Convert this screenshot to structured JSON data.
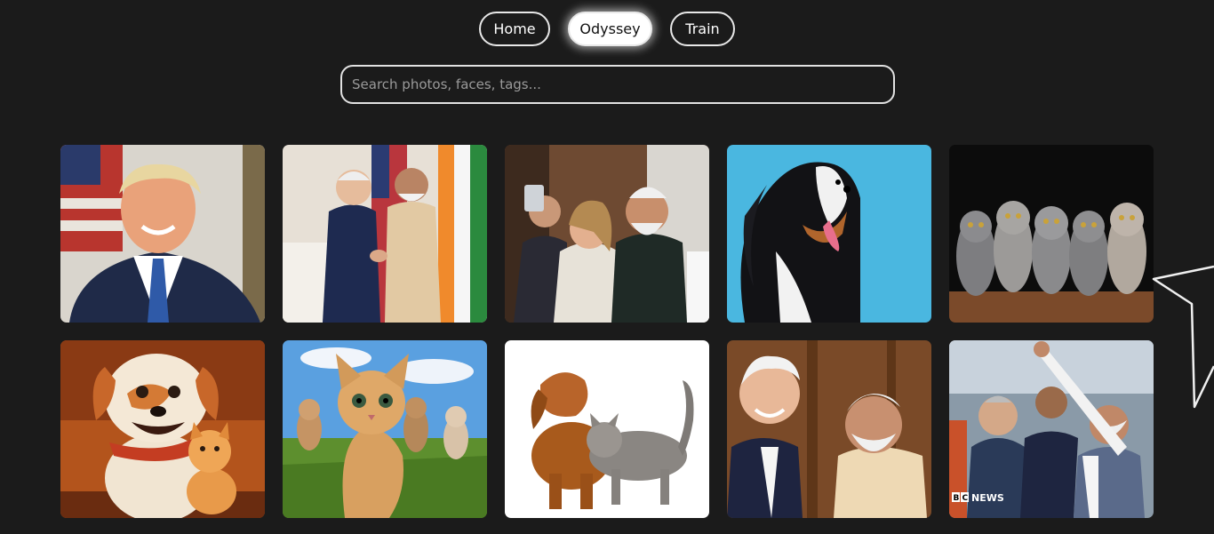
{
  "nav": {
    "home_label": "Home",
    "odyssey_label": "Odyssey",
    "train_label": "Train",
    "active": "Odyssey"
  },
  "search": {
    "placeholder": "Search photos, faces, tags...",
    "value": ""
  },
  "photos": [
    {
      "subject": "man in suit with flag"
    },
    {
      "subject": "two men shaking hands with flags"
    },
    {
      "subject": "group selfie"
    },
    {
      "subject": "dog on blue background"
    },
    {
      "subject": "five kittens"
    },
    {
      "subject": "cartoon dog and cat"
    },
    {
      "subject": "kittens running in grass"
    },
    {
      "subject": "dog and cat on white"
    },
    {
      "subject": "two men smiling"
    },
    {
      "subject": "men raising hands",
      "watermark": "BBC NEWS"
    }
  ],
  "colors": {
    "background": "#1b1b1b",
    "border": "#e8e8e8",
    "active_button": "#ffffff"
  }
}
